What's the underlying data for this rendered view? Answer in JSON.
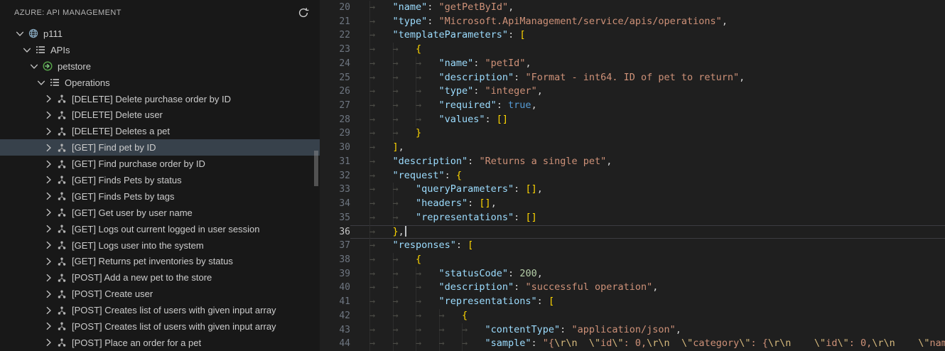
{
  "sidebar": {
    "title": "AZURE: API MANAGEMENT",
    "toolbar": {
      "refresh_label": "Refresh"
    },
    "tree": [
      {
        "label": "p111",
        "depth": 0,
        "expanded": true,
        "icon": "apim-service"
      },
      {
        "label": "APIs",
        "depth": 1,
        "expanded": true,
        "icon": "list"
      },
      {
        "label": "petstore",
        "depth": 2,
        "expanded": true,
        "icon": "api"
      },
      {
        "label": "Operations",
        "depth": 3,
        "expanded": true,
        "icon": "list"
      },
      {
        "label": "[DELETE] Delete purchase order by ID",
        "depth": 4,
        "expanded": false,
        "icon": "operation"
      },
      {
        "label": "[DELETE] Delete user",
        "depth": 4,
        "expanded": false,
        "icon": "operation"
      },
      {
        "label": "[DELETE] Deletes a pet",
        "depth": 4,
        "expanded": false,
        "icon": "operation"
      },
      {
        "label": "[GET] Find pet by ID",
        "depth": 4,
        "expanded": false,
        "icon": "operation",
        "selected": true
      },
      {
        "label": "[GET] Find purchase order by ID",
        "depth": 4,
        "expanded": false,
        "icon": "operation"
      },
      {
        "label": "[GET] Finds Pets by status",
        "depth": 4,
        "expanded": false,
        "icon": "operation"
      },
      {
        "label": "[GET] Finds Pets by tags",
        "depth": 4,
        "expanded": false,
        "icon": "operation"
      },
      {
        "label": "[GET] Get user by user name",
        "depth": 4,
        "expanded": false,
        "icon": "operation"
      },
      {
        "label": "[GET] Logs out current logged in user session",
        "depth": 4,
        "expanded": false,
        "icon": "operation"
      },
      {
        "label": "[GET] Logs user into the system",
        "depth": 4,
        "expanded": false,
        "icon": "operation"
      },
      {
        "label": "[GET] Returns pet inventories by status",
        "depth": 4,
        "expanded": false,
        "icon": "operation"
      },
      {
        "label": "[POST] Add a new pet to the store",
        "depth": 4,
        "expanded": false,
        "icon": "operation"
      },
      {
        "label": "[POST] Create user",
        "depth": 4,
        "expanded": false,
        "icon": "operation"
      },
      {
        "label": "[POST] Creates list of users with given input array",
        "depth": 4,
        "expanded": false,
        "icon": "operation"
      },
      {
        "label": "[POST] Creates list of users with given input array",
        "depth": 4,
        "expanded": false,
        "icon": "operation"
      },
      {
        "label": "[POST] Place an order for a pet",
        "depth": 4,
        "expanded": false,
        "icon": "operation"
      }
    ]
  },
  "editor": {
    "current_line": 36,
    "lines": [
      {
        "n": 20,
        "i": 1,
        "t": [
          [
            "k",
            "\"name\""
          ],
          [
            "p",
            ": "
          ],
          [
            "s",
            "\"getPetById\""
          ],
          [
            "p",
            ","
          ]
        ]
      },
      {
        "n": 21,
        "i": 1,
        "t": [
          [
            "k",
            "\"type\""
          ],
          [
            "p",
            ": "
          ],
          [
            "s",
            "\"Microsoft.ApiManagement/service/apis/operations\""
          ],
          [
            "p",
            ","
          ]
        ]
      },
      {
        "n": 22,
        "i": 1,
        "t": [
          [
            "k",
            "\"templateParameters\""
          ],
          [
            "p",
            ": "
          ],
          [
            "b",
            "["
          ]
        ]
      },
      {
        "n": 23,
        "i": 2,
        "t": [
          [
            "b",
            "{"
          ]
        ]
      },
      {
        "n": 24,
        "i": 3,
        "t": [
          [
            "k",
            "\"name\""
          ],
          [
            "p",
            ": "
          ],
          [
            "s",
            "\"petId\""
          ],
          [
            "p",
            ","
          ]
        ]
      },
      {
        "n": 25,
        "i": 3,
        "t": [
          [
            "k",
            "\"description\""
          ],
          [
            "p",
            ": "
          ],
          [
            "s",
            "\"Format - int64. ID of pet to return\""
          ],
          [
            "p",
            ","
          ]
        ]
      },
      {
        "n": 26,
        "i": 3,
        "t": [
          [
            "k",
            "\"type\""
          ],
          [
            "p",
            ": "
          ],
          [
            "s",
            "\"integer\""
          ],
          [
            "p",
            ","
          ]
        ]
      },
      {
        "n": 27,
        "i": 3,
        "t": [
          [
            "k",
            "\"required\""
          ],
          [
            "p",
            ": "
          ],
          [
            "kw",
            "true"
          ],
          [
            "p",
            ","
          ]
        ]
      },
      {
        "n": 28,
        "i": 3,
        "t": [
          [
            "k",
            "\"values\""
          ],
          [
            "p",
            ": "
          ],
          [
            "b",
            "[]"
          ]
        ]
      },
      {
        "n": 29,
        "i": 2,
        "t": [
          [
            "b",
            "}"
          ]
        ]
      },
      {
        "n": 30,
        "i": 1,
        "t": [
          [
            "b",
            "]"
          ],
          [
            "p",
            ","
          ]
        ]
      },
      {
        "n": 31,
        "i": 1,
        "t": [
          [
            "k",
            "\"description\""
          ],
          [
            "p",
            ": "
          ],
          [
            "s",
            "\"Returns a single pet\""
          ],
          [
            "p",
            ","
          ]
        ]
      },
      {
        "n": 32,
        "i": 1,
        "t": [
          [
            "k",
            "\"request\""
          ],
          [
            "p",
            ": "
          ],
          [
            "b",
            "{"
          ]
        ]
      },
      {
        "n": 33,
        "i": 2,
        "t": [
          [
            "k",
            "\"queryParameters\""
          ],
          [
            "p",
            ": "
          ],
          [
            "b",
            "[]"
          ],
          [
            "p",
            ","
          ]
        ]
      },
      {
        "n": 34,
        "i": 2,
        "t": [
          [
            "k",
            "\"headers\""
          ],
          [
            "p",
            ": "
          ],
          [
            "b",
            "[]"
          ],
          [
            "p",
            ","
          ]
        ]
      },
      {
        "n": 35,
        "i": 2,
        "t": [
          [
            "k",
            "\"representations\""
          ],
          [
            "p",
            ": "
          ],
          [
            "b",
            "[]"
          ]
        ]
      },
      {
        "n": 36,
        "i": 1,
        "cursor": true,
        "t": [
          [
            "b",
            "}"
          ],
          [
            "p",
            ","
          ]
        ]
      },
      {
        "n": 37,
        "i": 1,
        "t": [
          [
            "k",
            "\"responses\""
          ],
          [
            "p",
            ": "
          ],
          [
            "b",
            "["
          ]
        ]
      },
      {
        "n": 38,
        "i": 2,
        "t": [
          [
            "b",
            "{"
          ]
        ]
      },
      {
        "n": 39,
        "i": 3,
        "t": [
          [
            "k",
            "\"statusCode\""
          ],
          [
            "p",
            ": "
          ],
          [
            "n",
            "200"
          ],
          [
            "p",
            ","
          ]
        ]
      },
      {
        "n": 40,
        "i": 3,
        "t": [
          [
            "k",
            "\"description\""
          ],
          [
            "p",
            ": "
          ],
          [
            "s",
            "\"successful operation\""
          ],
          [
            "p",
            ","
          ]
        ]
      },
      {
        "n": 41,
        "i": 3,
        "t": [
          [
            "k",
            "\"representations\""
          ],
          [
            "p",
            ": "
          ],
          [
            "b",
            "["
          ]
        ]
      },
      {
        "n": 42,
        "i": 4,
        "t": [
          [
            "b",
            "{"
          ]
        ]
      },
      {
        "n": 43,
        "i": 5,
        "t": [
          [
            "k",
            "\"contentType\""
          ],
          [
            "p",
            ": "
          ],
          [
            "s",
            "\"application/json\""
          ],
          [
            "p",
            ","
          ]
        ]
      },
      {
        "n": 44,
        "i": 5,
        "t": [
          [
            "k",
            "\"sample\""
          ],
          [
            "p",
            ": "
          ],
          [
            "s",
            "\"{"
          ],
          [
            "e",
            "\\r\\n"
          ],
          [
            "s",
            "  "
          ],
          [
            "e",
            "\\\""
          ],
          [
            "s",
            "id"
          ],
          [
            "e",
            "\\\""
          ],
          [
            "s",
            ": 0,"
          ],
          [
            "e",
            "\\r\\n"
          ],
          [
            "s",
            "  "
          ],
          [
            "e",
            "\\\""
          ],
          [
            "s",
            "category"
          ],
          [
            "e",
            "\\\""
          ],
          [
            "s",
            ": {"
          ],
          [
            "e",
            "\\r\\n"
          ],
          [
            "s",
            "    "
          ],
          [
            "e",
            "\\\""
          ],
          [
            "s",
            "id"
          ],
          [
            "e",
            "\\\""
          ],
          [
            "s",
            ": 0,"
          ],
          [
            "e",
            "\\r\\n"
          ],
          [
            "s",
            "    "
          ],
          [
            "e",
            "\\\""
          ],
          [
            "s",
            "name"
          ]
        ]
      }
    ]
  },
  "colors": {
    "sidebar_background": "#181818",
    "editor_background": "#1f1f1f",
    "selection_background": "#37414b",
    "syntax": {
      "k": "#9cdcfe",
      "p": "#d4d4d4",
      "s": "#ce9178",
      "e": "#d7ba7d",
      "n": "#b5cea8",
      "b": "#ffd700",
      "kw": "#569cd6"
    }
  }
}
